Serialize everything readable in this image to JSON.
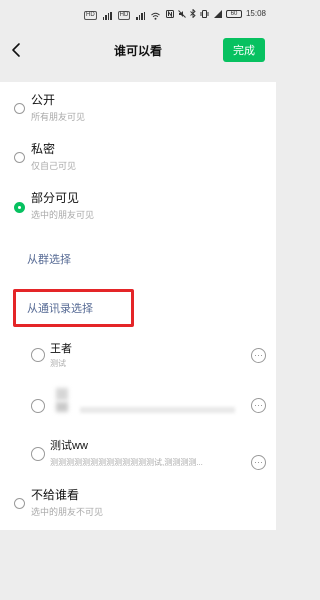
{
  "status_bar": {
    "sim_chip_1": "HD",
    "sim_chip_2": "HD",
    "battery": "60",
    "time": "15:08"
  },
  "nav": {
    "title": "谁可以看",
    "done_label": "完成"
  },
  "options": {
    "public": {
      "title": "公开",
      "desc": "所有朋友可见",
      "selected": false
    },
    "private": {
      "title": "私密",
      "desc": "仅自己可见",
      "selected": false
    },
    "partial": {
      "title": "部分可见",
      "desc": "选中的朋友可见",
      "selected": true
    },
    "exclude": {
      "title": "不给谁看",
      "desc": "选中的朋友不可见",
      "selected": false
    }
  },
  "links": {
    "from_group": "从群选择",
    "from_contacts": "从通讯录选择"
  },
  "tags": [
    {
      "name": "王者",
      "members": "测试"
    },
    {
      "name": "",
      "members": ""
    },
    {
      "name": "测试ww",
      "members": "测测测测测测测测测测测测测试,测测测测..."
    }
  ],
  "colors": {
    "accent": "#07c160",
    "link": "#576b95",
    "highlight": "#e42528",
    "background": "#ededed"
  }
}
